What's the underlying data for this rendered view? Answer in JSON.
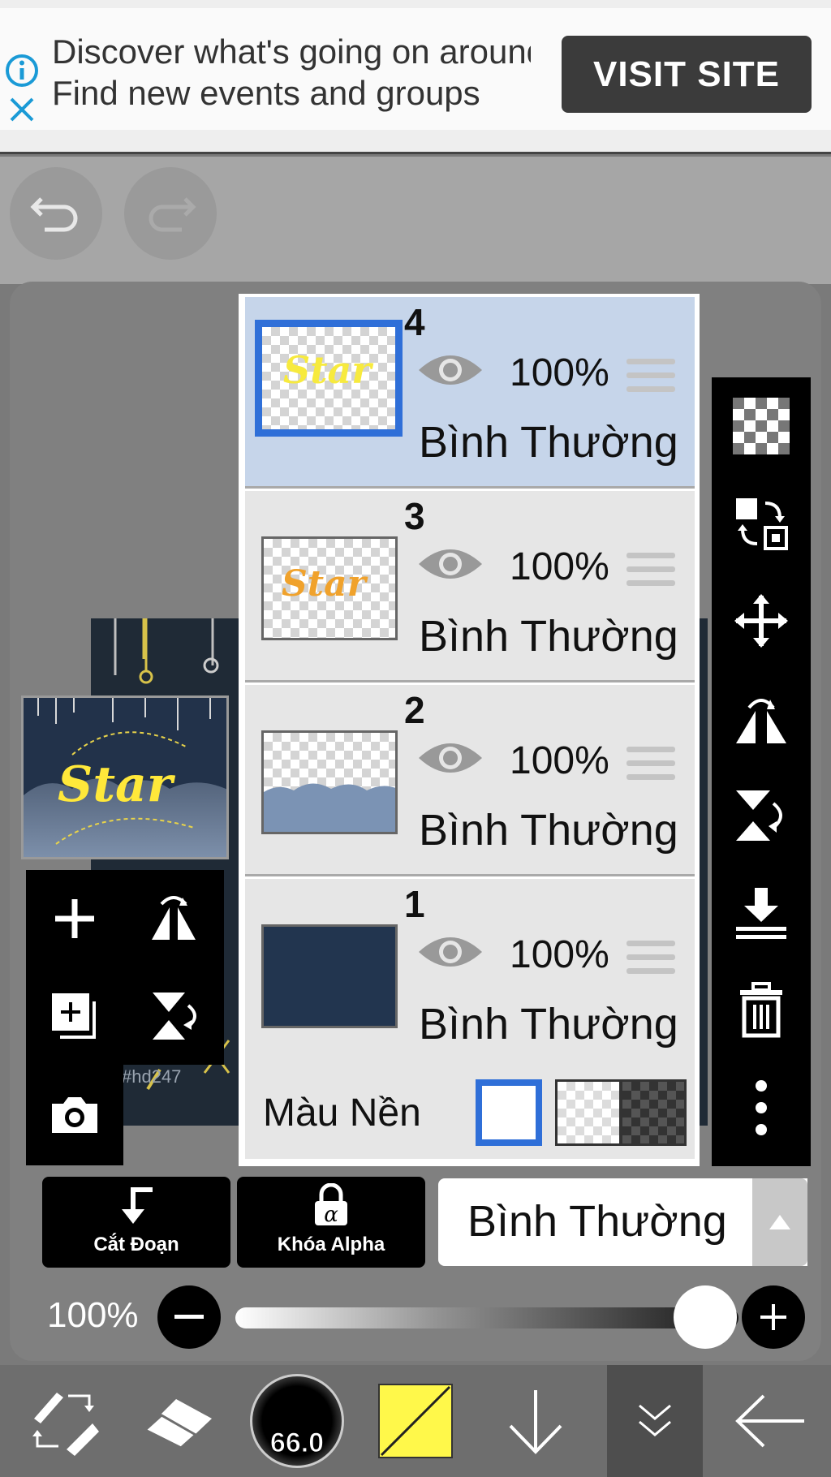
{
  "ad": {
    "line1": "Discover what's going on around",
    "line2": "Find new events and groups",
    "cta": "VISIT SITE"
  },
  "canvas": {
    "watermark": "#hd247",
    "thumbnail_text": "Star"
  },
  "layers": [
    {
      "number": "4",
      "opacity": "100%",
      "blend": "Bình Thường",
      "selected": true,
      "thumb_text": "Star"
    },
    {
      "number": "3",
      "opacity": "100%",
      "blend": "Bình Thường",
      "selected": false,
      "thumb_text": "Star"
    },
    {
      "number": "2",
      "opacity": "100%",
      "blend": "Bình Thường",
      "selected": false
    },
    {
      "number": "1",
      "opacity": "100%",
      "blend": "Bình Thường",
      "selected": false
    }
  ],
  "background": {
    "label": "Màu Nền",
    "options": [
      "white",
      "transparent",
      "dark-checker"
    ],
    "selected": "white"
  },
  "controls": {
    "clip_label": "Cắt Đoạn",
    "alpha_lock_label": "Khóa Alpha",
    "blend_mode": "Bình Thường",
    "opacity_value": "100%",
    "opacity_fraction": 1.0
  },
  "bottom": {
    "brush_size": "66.0",
    "color": "#fff84a"
  },
  "colors": {
    "accent": "#2f6fd8",
    "layer_selected_bg": "#c6d5ea",
    "layer1_fill": "#22354f"
  }
}
